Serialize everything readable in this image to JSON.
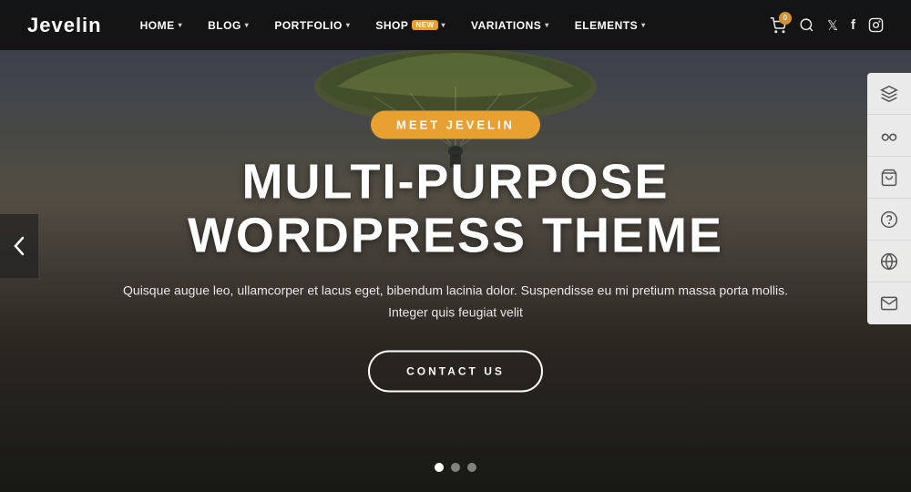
{
  "brand": {
    "name": "Jevelin"
  },
  "navbar": {
    "items": [
      {
        "label": "Home",
        "hasDropdown": true
      },
      {
        "label": "Blog",
        "hasDropdown": true
      },
      {
        "label": "Portfolio",
        "hasDropdown": true
      },
      {
        "label": "Shop",
        "hasDropdown": true,
        "badge": "NEW"
      },
      {
        "label": "Variations",
        "hasDropdown": true
      },
      {
        "label": "Elements",
        "hasDropdown": true
      }
    ],
    "cart_count": "0"
  },
  "hero": {
    "tagline": "MEET JEVELIN",
    "title": "MULTI-PURPOSE WORDPRESS THEME",
    "subtitle_line1": "Quisque augue leo, ullamcorper et lacus eget, bibendum lacinia dolor. Suspendisse eu mi pretium massa porta mollis.",
    "subtitle_line2": "Integer quis feugiat velit",
    "cta_label": "CONTACT US"
  },
  "dots": [
    {
      "state": "active"
    },
    {
      "state": "inactive"
    },
    {
      "state": "inactive"
    }
  ],
  "sidebar": {
    "icons": [
      {
        "name": "layers-icon",
        "symbol": "⊞"
      },
      {
        "name": "glasses-icon",
        "symbol": "◎"
      },
      {
        "name": "bag-icon",
        "symbol": "🛍"
      },
      {
        "name": "help-icon",
        "symbol": "?"
      },
      {
        "name": "globe-icon",
        "symbol": "⊕"
      },
      {
        "name": "mail-icon",
        "symbol": "✉"
      }
    ]
  }
}
